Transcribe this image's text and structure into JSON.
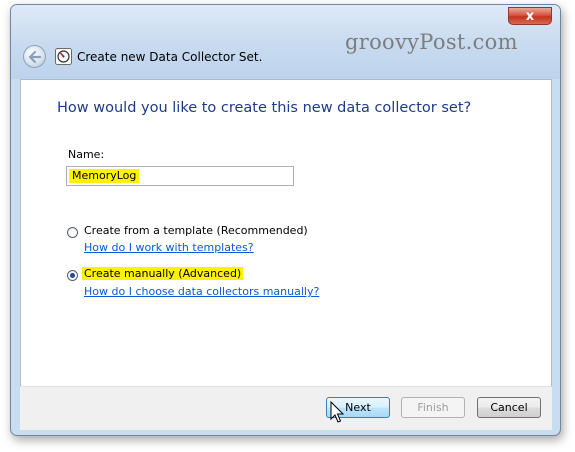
{
  "window": {
    "title": "Create new Data Collector Set.",
    "close_label": "x"
  },
  "watermark": "groovyPost.com",
  "main": {
    "heading": "How would you like to create this new data collector set?",
    "name_label": "Name:",
    "name_value": "MemoryLog",
    "options": [
      {
        "label": "Create from a template (Recommended)",
        "link": "How do I work with templates?",
        "selected": false
      },
      {
        "label": "Create manually (Advanced)",
        "link": "How do I choose data collectors manually?",
        "selected": true
      }
    ]
  },
  "buttons": {
    "next": "Next",
    "finish": "Finish",
    "cancel": "Cancel"
  },
  "colors": {
    "heading": "#1e3b8a",
    "link": "#0b5ad8",
    "highlight": "#fff200"
  }
}
